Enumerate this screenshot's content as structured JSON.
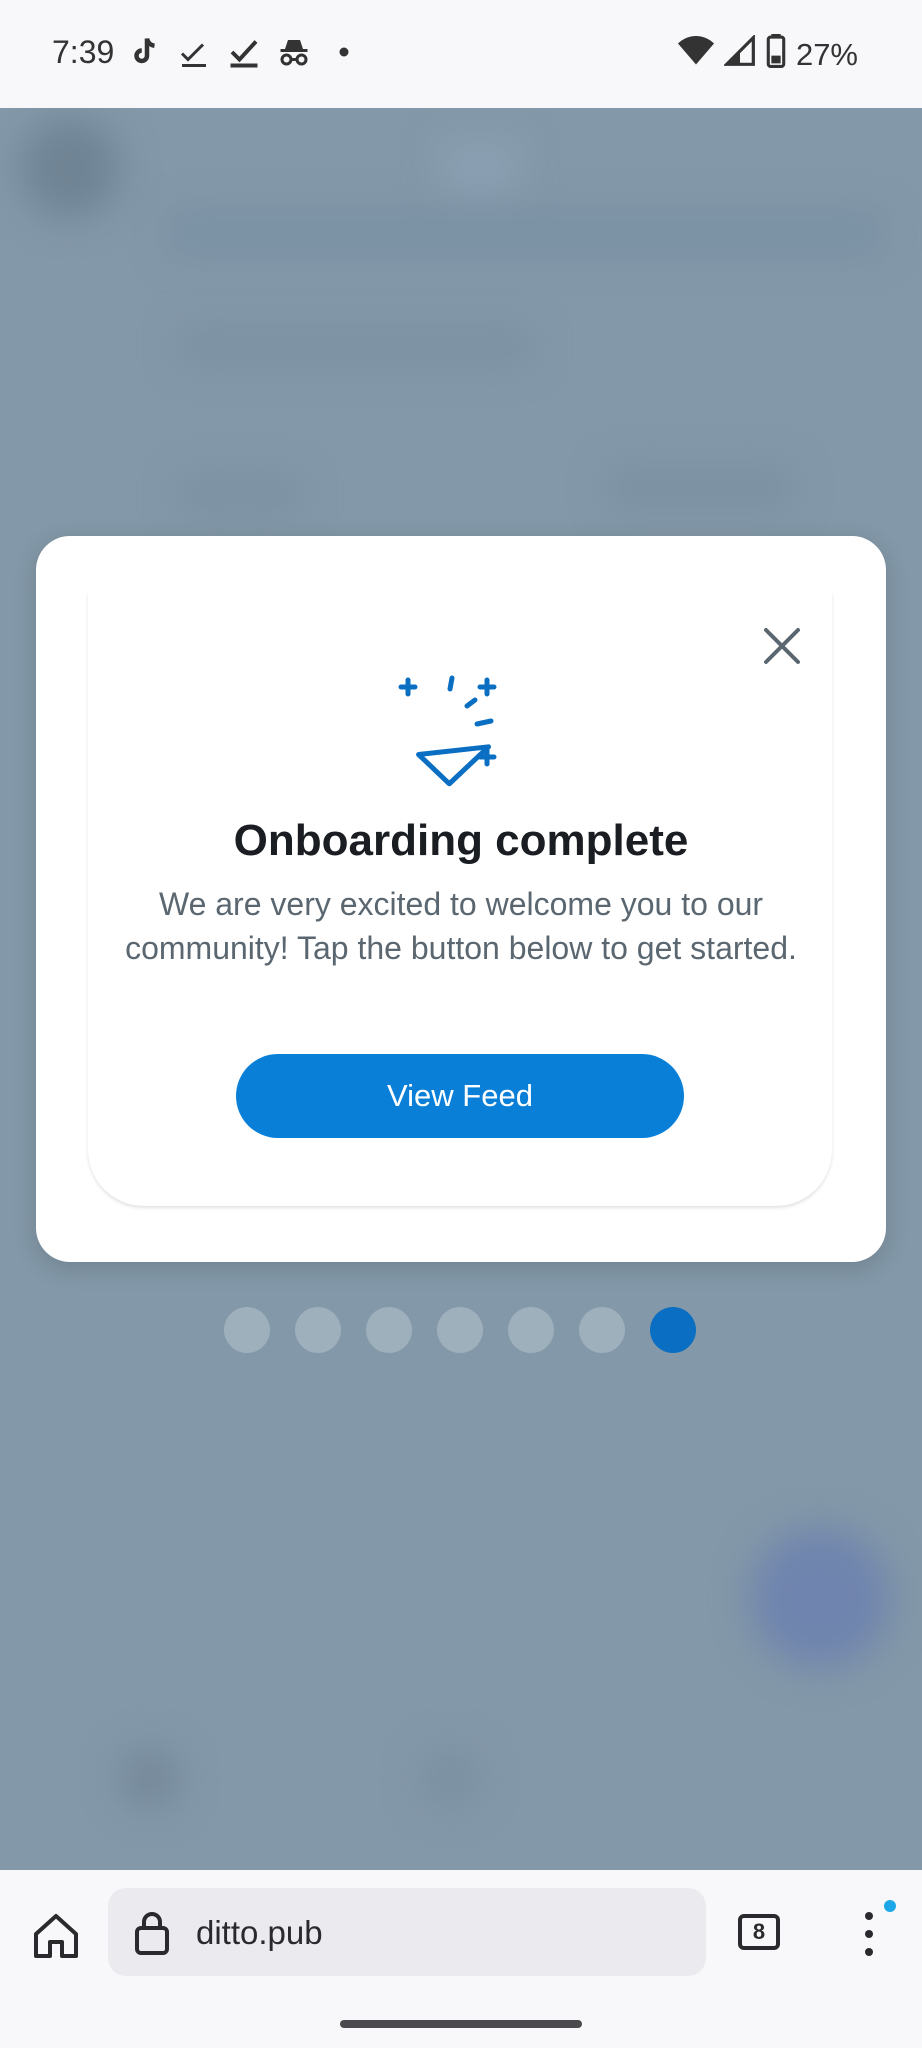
{
  "status_bar": {
    "time": "7:39",
    "battery": "27%",
    "left_icons": [
      "tiktok-icon",
      "check-icon",
      "check-icon",
      "incognito-icon",
      "dot-icon"
    ],
    "right_icons": [
      "wifi-icon",
      "signal-icon",
      "battery-icon"
    ]
  },
  "modal": {
    "icon": "party-popper-icon",
    "title": "Onboarding complete",
    "body": "We are very excited to welcome you to our community! Tap the button below to get started.",
    "primary_button": "View Feed",
    "close_icon": "close-icon",
    "accent_color": "#0a7fd8"
  },
  "pagination": {
    "total": 7,
    "active_index": 6
  },
  "browser": {
    "url": "ditto.pub",
    "tab_count": "8"
  }
}
